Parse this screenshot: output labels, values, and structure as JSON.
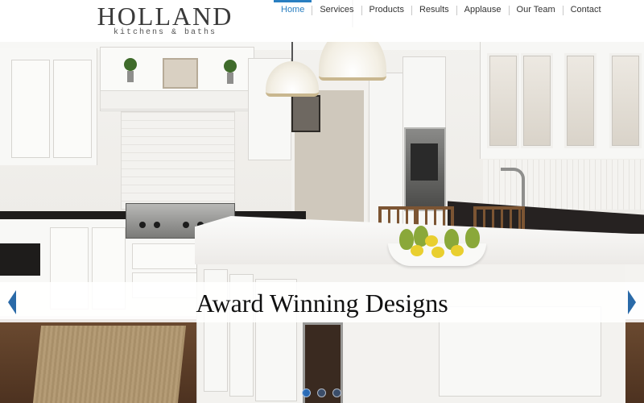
{
  "brand": {
    "title": "Holland",
    "subtitle": "kitchens & baths"
  },
  "nav": {
    "items": [
      {
        "label": "Home",
        "active": true
      },
      {
        "label": "Services",
        "active": false
      },
      {
        "label": "Products",
        "active": false
      },
      {
        "label": "Results",
        "active": false
      },
      {
        "label": "Applause",
        "active": false
      },
      {
        "label": "Our Team",
        "active": false
      },
      {
        "label": "Contact",
        "active": false
      }
    ]
  },
  "slider": {
    "caption": "Award Winning Designs",
    "slide_count": 3,
    "active_slide": 1,
    "prev_icon": "chevron-left-icon",
    "next_icon": "chevron-right-icon"
  },
  "colors": {
    "accent": "#2a7fc1",
    "arrow": "#2a6aa8",
    "text": "#333333"
  }
}
